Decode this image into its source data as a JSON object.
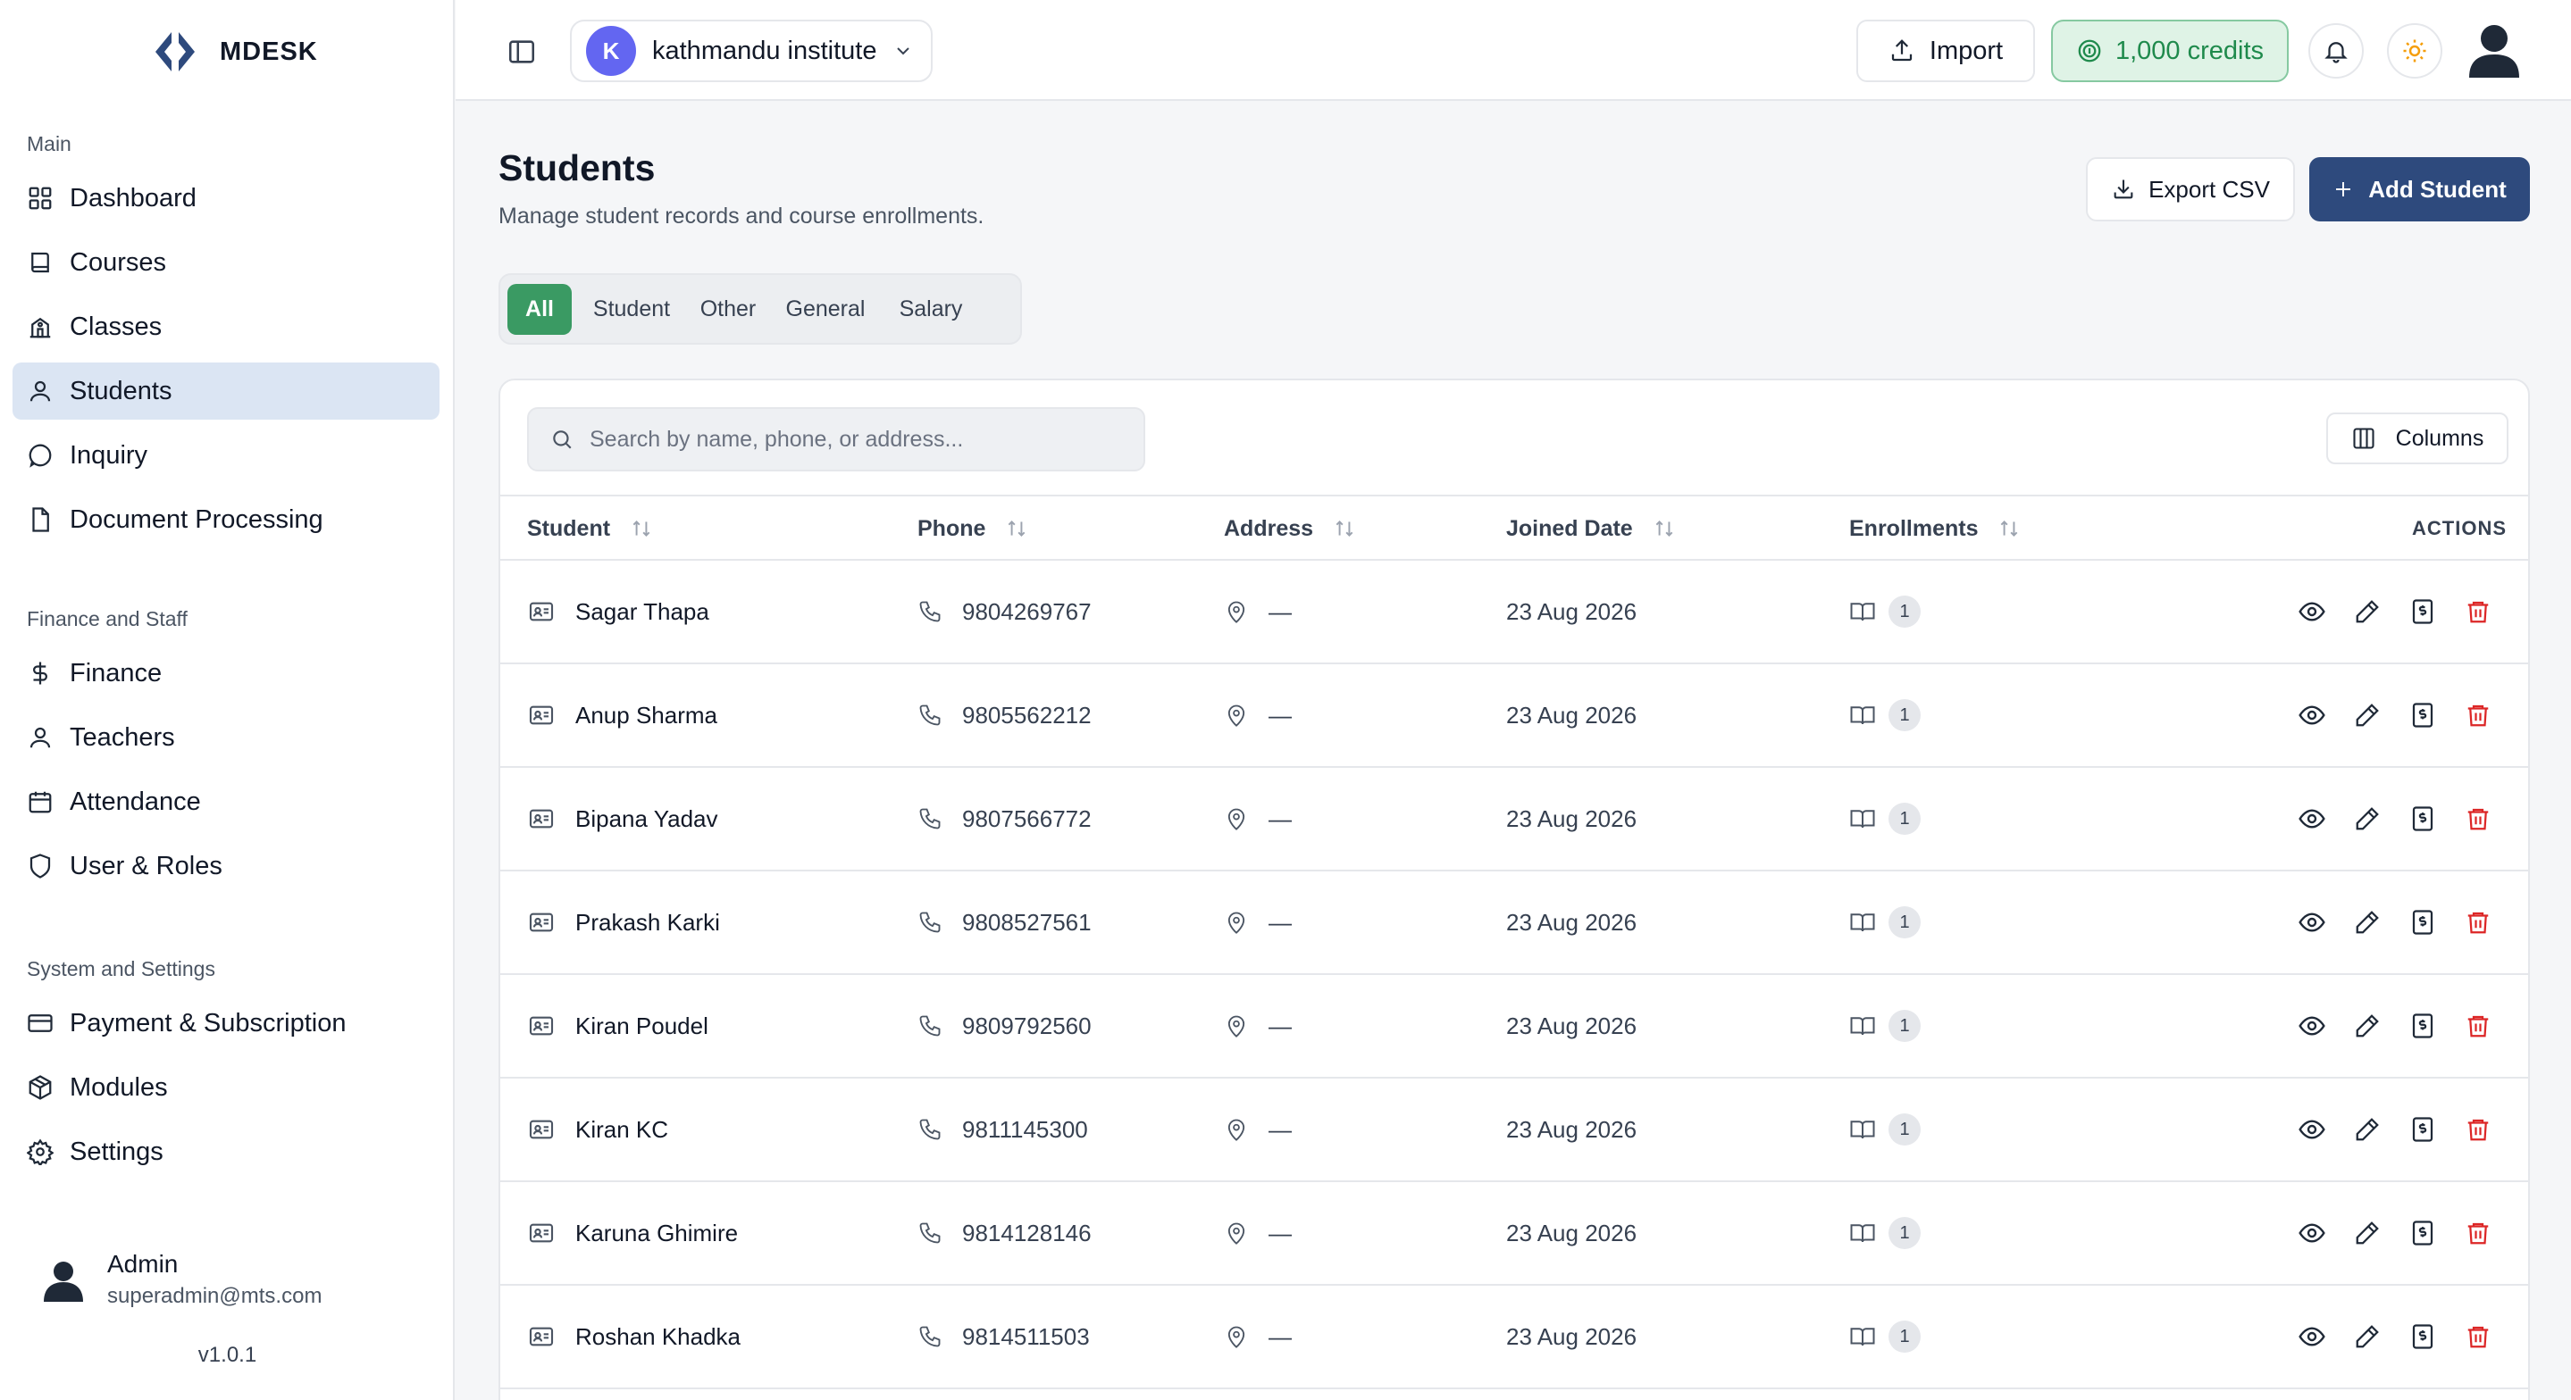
{
  "brand": {
    "name": "MDESK"
  },
  "sidebar": {
    "sections": [
      {
        "title": "Main",
        "items": [
          {
            "label": "Dashboard",
            "icon": "dashboard-icon"
          },
          {
            "label": "Courses",
            "icon": "book-icon"
          },
          {
            "label": "Classes",
            "icon": "school-icon"
          },
          {
            "label": "Students",
            "icon": "user-icon",
            "active": true
          },
          {
            "label": "Inquiry",
            "icon": "message-circle-icon"
          },
          {
            "label": "Document Processing",
            "icon": "file-icon"
          }
        ]
      },
      {
        "title": "Finance and Staff",
        "items": [
          {
            "label": "Finance",
            "icon": "dollar-icon"
          },
          {
            "label": "Teachers",
            "icon": "user-icon"
          },
          {
            "label": "Attendance",
            "icon": "calendar-icon"
          },
          {
            "label": "User & Roles",
            "icon": "shield-icon"
          }
        ]
      },
      {
        "title": "System and Settings",
        "items": [
          {
            "label": "Payment & Subscription",
            "icon": "credit-card-icon"
          },
          {
            "label": "Modules",
            "icon": "package-icon"
          },
          {
            "label": "Settings",
            "icon": "gear-icon"
          }
        ]
      }
    ],
    "user": {
      "name": "Admin",
      "email": "superadmin@mts.com"
    },
    "version": "v1.0.1"
  },
  "topbar": {
    "org": {
      "initial": "K",
      "name": "kathmandu institute"
    },
    "import_label": "Import",
    "credits_label": "1,000 credits"
  },
  "page": {
    "title": "Students",
    "subtitle": "Manage student records and course enrollments.",
    "export_label": "Export CSV",
    "add_label": "Add Student",
    "tabs": [
      "All",
      "Student",
      "Other",
      "General",
      "Salary"
    ],
    "active_tab": "All",
    "search_placeholder": "Search by name, phone, or address...",
    "columns_label": "Columns"
  },
  "table": {
    "headers": {
      "student": "Student",
      "phone": "Phone",
      "address": "Address",
      "joined": "Joined Date",
      "enrollments": "Enrollments",
      "actions": "ACTIONS"
    },
    "rows": [
      {
        "name": "Sagar Thapa",
        "phone": "9804269767",
        "address": "—",
        "joined": "23 Aug 2026",
        "enrollments": "1"
      },
      {
        "name": "Anup Sharma",
        "phone": "9805562212",
        "address": "—",
        "joined": "23 Aug 2026",
        "enrollments": "1"
      },
      {
        "name": "Bipana Yadav",
        "phone": "9807566772",
        "address": "—",
        "joined": "23 Aug 2026",
        "enrollments": "1"
      },
      {
        "name": "Prakash Karki",
        "phone": "9808527561",
        "address": "—",
        "joined": "23 Aug 2026",
        "enrollments": "1"
      },
      {
        "name": "Kiran Poudel",
        "phone": "9809792560",
        "address": "—",
        "joined": "23 Aug 2026",
        "enrollments": "1"
      },
      {
        "name": "Kiran KC",
        "phone": "9811145300",
        "address": "—",
        "joined": "23 Aug 2026",
        "enrollments": "1"
      },
      {
        "name": "Karuna Ghimire",
        "phone": "9814128146",
        "address": "—",
        "joined": "23 Aug 2026",
        "enrollments": "1"
      },
      {
        "name": "Roshan Khadka",
        "phone": "9814511503",
        "address": "—",
        "joined": "23 Aug 2026",
        "enrollments": "1"
      }
    ]
  },
  "colors": {
    "primary": "#2e4a7d",
    "tab_active": "#3a9a63",
    "credits_text": "#1f8a4c",
    "delete": "#dc2626",
    "active_nav": "#dbe5f3"
  }
}
